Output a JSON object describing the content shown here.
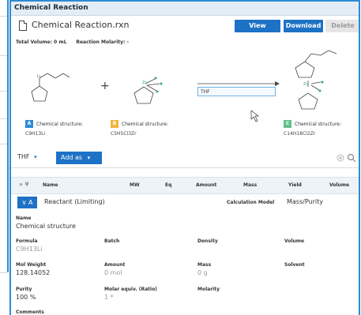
{
  "panel": {
    "title": "Chemical Reaction",
    "file_name": "Chemical Reaction.rxn",
    "buttons": {
      "view": "View",
      "download": "Download",
      "delete": "Delete"
    },
    "total_volume_label": "Total Volume: 0 mL",
    "reaction_molarity_label": "Reaction Molarity: -"
  },
  "reaction": {
    "solvent_box": "THF",
    "components": [
      {
        "chip": "A",
        "chip_color": "#2e8bd4",
        "label": "Chemical structure:",
        "formula": "C9H13Li"
      },
      {
        "chip": "B",
        "chip_color": "#f3b33d",
        "label": "Chemical structure:",
        "formula": "C5H5Cl3Zr"
      },
      {
        "chip": "C",
        "chip_color": "#63c08b",
        "label": "Chemical structure:",
        "formula": "C14H18Cl2Zr"
      }
    ],
    "plus_sign": "+"
  },
  "toolbar": {
    "solvent": "THF",
    "solvent_arrow": "▾",
    "add_as": "Add as",
    "add_as_arrow": "▾",
    "search_icon": "search-icon",
    "clear_icon": "clear-icon"
  },
  "table": {
    "expand_icons": "» ¥",
    "headers": [
      "Name",
      "MW",
      "Eq",
      "Amount",
      "Mass",
      "Yield",
      "Volume"
    ]
  },
  "reactant": {
    "toggle": "∨ A",
    "label": "Reactant (Limiting)",
    "calc_label": "Calculation Model",
    "calc_value": "Mass/Purity",
    "name_label": "Name",
    "name_value": "Chemical structure",
    "formula_label": "Formula",
    "formula_value": "C9H13Li",
    "batch_label": "Batch",
    "density_label": "Density",
    "volume_label": "Volume",
    "mw_label": "Mol Weight",
    "mw_value": "128.14052",
    "amount_label": "Amount",
    "amount_value": "0 mol",
    "mass_label": "Mass",
    "mass_value": "0 g",
    "solvent_label": "Solvent",
    "purity_label": "Purity",
    "purity_value": "100 %",
    "molar_equiv_label": "Molar equiv. (Ratio)",
    "molar_equiv_value": "1 *",
    "molarity_label": "Molarity",
    "comments_label": "Comments"
  }
}
